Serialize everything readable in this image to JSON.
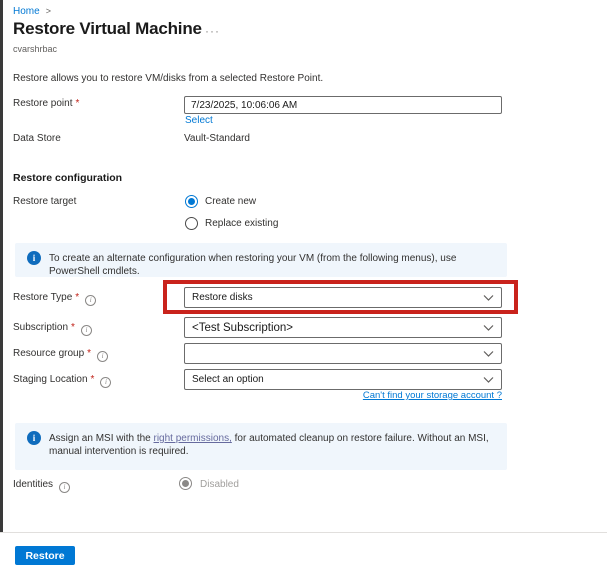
{
  "page": {
    "breadcrumb": "Home",
    "title": "Restore Virtual Machine",
    "more_label": "···",
    "subtitle": "cvarshrbac",
    "description": "Restore allows you to restore VM/disks from a selected Restore Point."
  },
  "colors": {
    "accent": "#0078d4",
    "highlight_red": "#c9231c",
    "banner_bg": "#f0f6fc",
    "disabled_text": "#a19f9d"
  },
  "icons": {
    "breadcrumb_chevron": ">",
    "info": "i",
    "ellipsis": "···"
  },
  "restore_point": {
    "label": "Restore point",
    "required": "*",
    "value": "7/23/2025, 10:06:06 AM",
    "select_link": "Select"
  },
  "data_store": {
    "label": "Data Store",
    "value": "Vault-Standard"
  },
  "restore_configuration": {
    "heading": "Restore configuration",
    "restore_target": {
      "label": "Restore target",
      "options": [
        {
          "label": "Create new",
          "selected": true
        },
        {
          "label": "Replace existing",
          "selected": false
        }
      ]
    },
    "info_banner": "To create an alternate configuration when restoring your VM (from the following menus), use PowerShell cmdlets.",
    "fields": [
      {
        "label": "Restore Type",
        "required": "*",
        "value": "Restore disks",
        "highlighted": true
      },
      {
        "label": "Subscription",
        "required": "*",
        "value": "<Test Subscription>",
        "highlighted": false
      },
      {
        "label": "Resource group",
        "required": "*",
        "value": "",
        "highlighted": false
      },
      {
        "label": "Staging Location",
        "required": "*",
        "value": "Select an option",
        "highlighted": false
      }
    ],
    "storage_link": "Can't find your storage account ?",
    "msi_banner": {
      "prefix": "Assign an MSI with the ",
      "link": "right permissions,",
      "suffix": " for automated cleanup on restore failure. Without an MSI, manual intervention is required."
    },
    "identities": {
      "label": "Identities",
      "value": "Disabled"
    }
  },
  "footer": {
    "restore_button": "Restore"
  }
}
